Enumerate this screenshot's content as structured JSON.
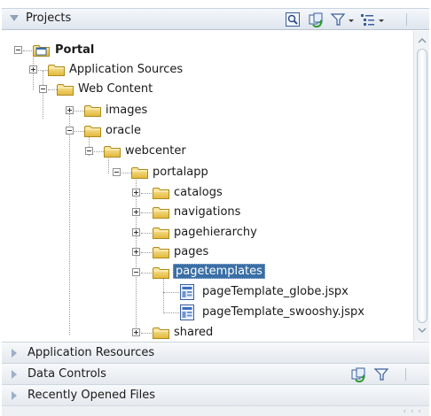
{
  "header": {
    "title": "Projects",
    "icons": [
      "find-icon",
      "sync-icon",
      "filter-icon",
      "view-options-icon"
    ]
  },
  "tree": {
    "root_label": "Portal",
    "items": {
      "application_sources": "Application Sources",
      "web_content": "Web Content",
      "images": "images",
      "oracle": "oracle",
      "webcenter": "webcenter",
      "portalapp": "portalapp",
      "catalogs": "catalogs",
      "navigations": "navigations",
      "pagehierarchy": "pagehierarchy",
      "pages": "pages",
      "pagetemplates": "pagetemplates",
      "file_globe": "pageTemplate_globe.jspx",
      "file_swooshy": "pageTemplate_swooshy.jspx",
      "shared": "shared"
    },
    "selected": "pagetemplates"
  },
  "sections": {
    "application_resources": "Application Resources",
    "data_controls": "Data Controls",
    "recently_opened": "Recently Opened Files"
  },
  "colors": {
    "folder": "#e8c64a",
    "selection": "#3a6ea5",
    "header_bg": "#dfe6ee"
  }
}
